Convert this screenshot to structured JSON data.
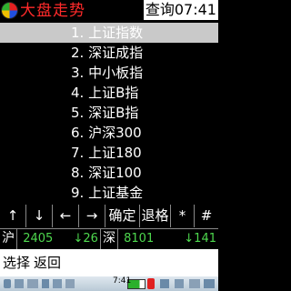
{
  "title_bar": {
    "title": "大盘走势",
    "query_time": "查询07:41"
  },
  "menu": [
    "1. 上证指数",
    "2. 深证成指",
    "3. 中小板指",
    "4. 上证B指",
    "5. 深证B指",
    "6. 沪深300",
    "7. 上证180",
    "8. 深证100",
    "9. 上证基金"
  ],
  "keys": [
    {
      "label": "↑"
    },
    {
      "label": "↓"
    },
    {
      "label": "←"
    },
    {
      "label": "→"
    },
    {
      "label": "确定"
    },
    {
      "label": "退格"
    },
    {
      "label": "*"
    },
    {
      "label": "#"
    }
  ],
  "index_bar": {
    "sh_name": "沪",
    "sh_value": "2405",
    "sh_change": "↓26",
    "sz_name": "深",
    "sz_value": "8101",
    "sz_change": "↓141"
  },
  "softkeys": {
    "left": "选择",
    "right": "返回"
  },
  "status_bar": {
    "clock": "7:41"
  },
  "colors": {
    "title": "#ff2a2a",
    "index": "#4ed84e",
    "selected": "#c9c9c9"
  }
}
